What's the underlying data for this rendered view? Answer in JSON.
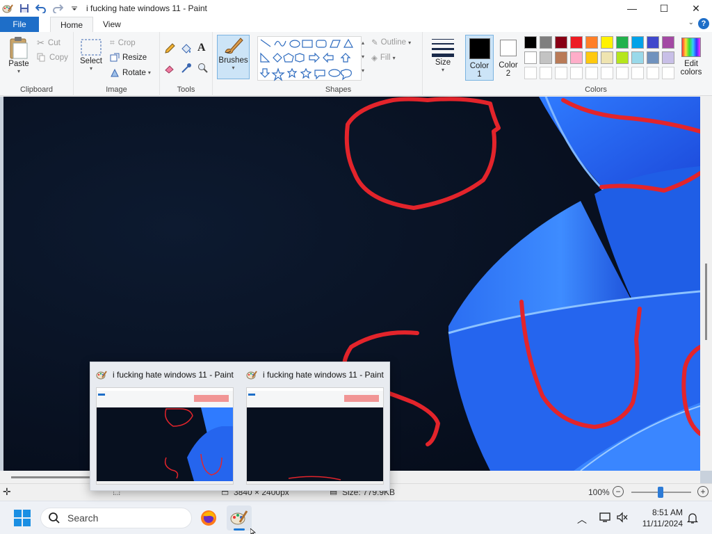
{
  "window": {
    "title": "i fucking hate windows 11 - Paint",
    "controls": {
      "minimize": "—",
      "maximize": "☐",
      "close": "✕"
    }
  },
  "tabs": [
    {
      "label": "File"
    },
    {
      "label": "Home"
    },
    {
      "label": "View"
    }
  ],
  "help_label": "?",
  "ribbon": {
    "clipboard": {
      "label": "Clipboard",
      "paste": "Paste",
      "cut": "Cut",
      "copy": "Copy"
    },
    "image": {
      "label": "Image",
      "select": "Select",
      "crop": "Crop",
      "resize": "Resize",
      "rotate": "Rotate"
    },
    "tools": {
      "label": "Tools"
    },
    "brushes": {
      "label": "Brushes"
    },
    "shapes": {
      "label": "Shapes",
      "outline": "Outline",
      "fill": "Fill"
    },
    "size": {
      "label": "Size"
    },
    "color1": {
      "label": "Color",
      "num": "1",
      "color": "#000000"
    },
    "color2": {
      "label": "Color",
      "num": "2",
      "color": "#ffffff"
    },
    "colors": {
      "label": "Colors"
    },
    "edit_colors": {
      "line1": "Edit",
      "line2": "colors"
    },
    "palette_row1": [
      "#000000",
      "#7f7f7f",
      "#880015",
      "#ed1c24",
      "#ff7f27",
      "#fff200",
      "#22b14c",
      "#00a2e8",
      "#3f48cc",
      "#a349a4"
    ],
    "palette_row2": [
      "#ffffff",
      "#c3c3c3",
      "#b97a57",
      "#ffaec9",
      "#ffc90e",
      "#efe4b0",
      "#b5e61d",
      "#99d9ea",
      "#7092be",
      "#c8bfe7"
    ],
    "palette_row3": [
      "#ffffff",
      "#ffffff",
      "#ffffff",
      "#ffffff",
      "#ffffff",
      "#ffffff",
      "#ffffff",
      "#ffffff",
      "#ffffff",
      "#ffffff"
    ]
  },
  "status": {
    "dimensions": "3840 × 2400px",
    "size": "Size: 779.9KB",
    "zoom": "100%",
    "zoom_minus": "−",
    "zoom_plus": "+"
  },
  "taskbar": {
    "search_placeholder": "Search",
    "time": "8:51 AM",
    "date": "11/11/2024"
  },
  "thumbnails": [
    {
      "title": "i fucking hate windows 11 - Paint"
    },
    {
      "title": "i fucking hate windows 11 - Paint"
    }
  ]
}
